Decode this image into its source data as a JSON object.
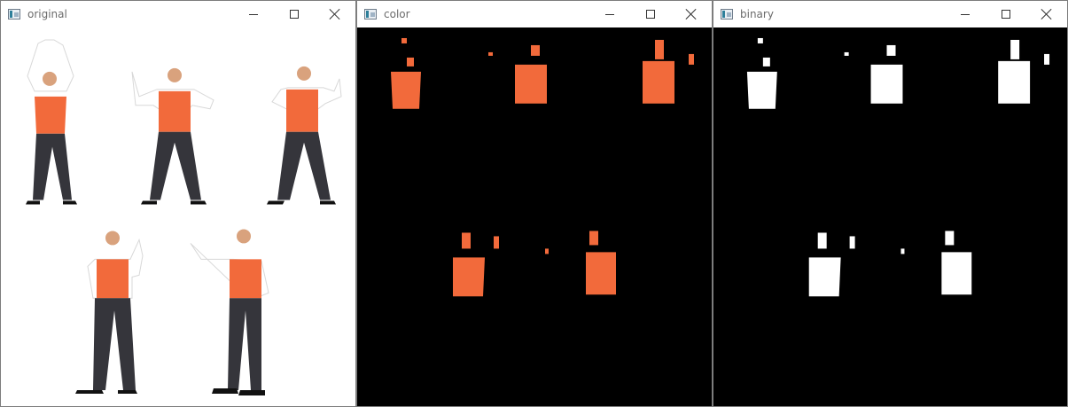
{
  "windows": [
    {
      "title": "original",
      "view": "original"
    },
    {
      "title": "color",
      "view": "color"
    },
    {
      "title": "binary",
      "view": "binary"
    }
  ],
  "colors": {
    "vest": "#f26a3b",
    "shirt": "#ffffff",
    "trousers": "#35353b",
    "skin": "#d9a27d",
    "mask_white": "#ffffff",
    "canvas_black": "#000000"
  },
  "icons": {
    "app": "window-app-icon",
    "minimize": "minimize-icon",
    "maximize": "maximize-icon",
    "close": "close-icon"
  }
}
